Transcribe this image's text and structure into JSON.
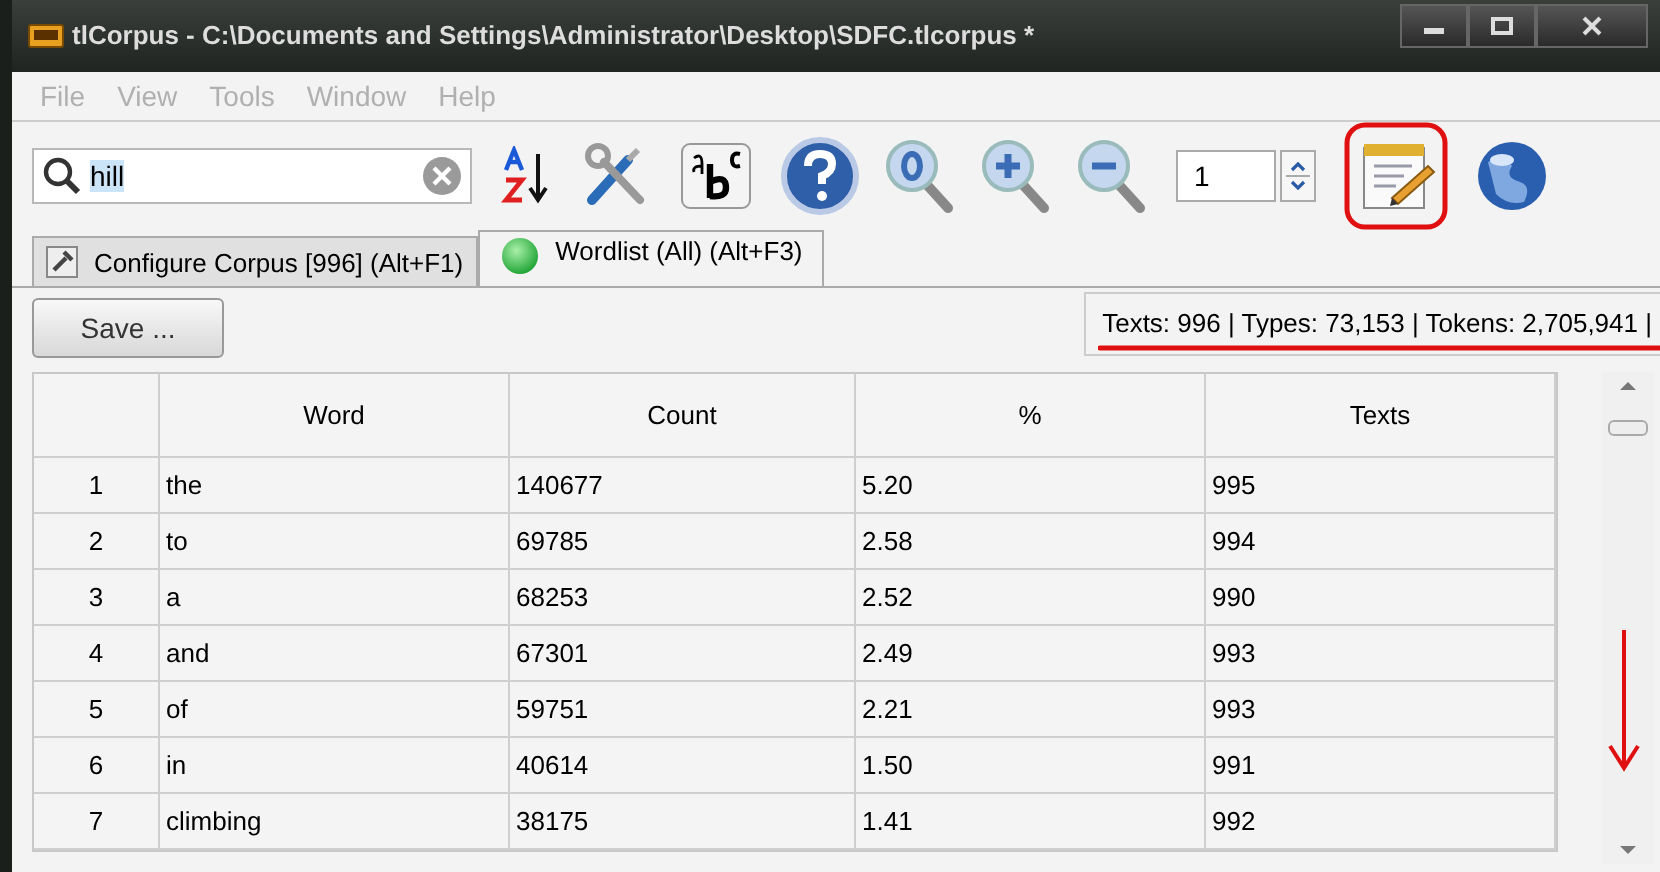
{
  "window": {
    "title": "tlCorpus - C:\\Documents and Settings\\Administrator\\Desktop\\SDFC.tlcorpus *"
  },
  "menu": [
    {
      "label": "File",
      "disabled": true
    },
    {
      "label": "View",
      "disabled": true
    },
    {
      "label": "Tools",
      "disabled": true
    },
    {
      "label": "Window",
      "disabled": true
    },
    {
      "label": "Help",
      "disabled": true
    }
  ],
  "search": {
    "value": "hill"
  },
  "page_spinner": {
    "value": "1"
  },
  "tabs": [
    {
      "label": "Configure Corpus [996] (Alt+F1)",
      "selected": false,
      "kind": "config"
    },
    {
      "label": "Wordlist (All) (Alt+F3)",
      "selected": true,
      "kind": "wordlist"
    }
  ],
  "save_button": "Save ...",
  "stats": "Texts: 996 | Types: 73,153 | Tokens: 2,705,941 |",
  "table": {
    "columns": [
      "",
      "Word",
      "Count",
      "%",
      "Texts"
    ],
    "rows": [
      [
        "1",
        "the",
        "140677",
        "5.20",
        "995"
      ],
      [
        "2",
        "to",
        "69785",
        "2.58",
        "994"
      ],
      [
        "3",
        "a",
        "68253",
        "2.52",
        "990"
      ],
      [
        "4",
        "and",
        "67301",
        "2.49",
        "993"
      ],
      [
        "5",
        "of",
        "59751",
        "2.21",
        "993"
      ],
      [
        "6",
        "in",
        "40614",
        "1.50",
        "991"
      ],
      [
        "7",
        "climbing",
        "38175",
        "1.41",
        "992"
      ]
    ]
  }
}
